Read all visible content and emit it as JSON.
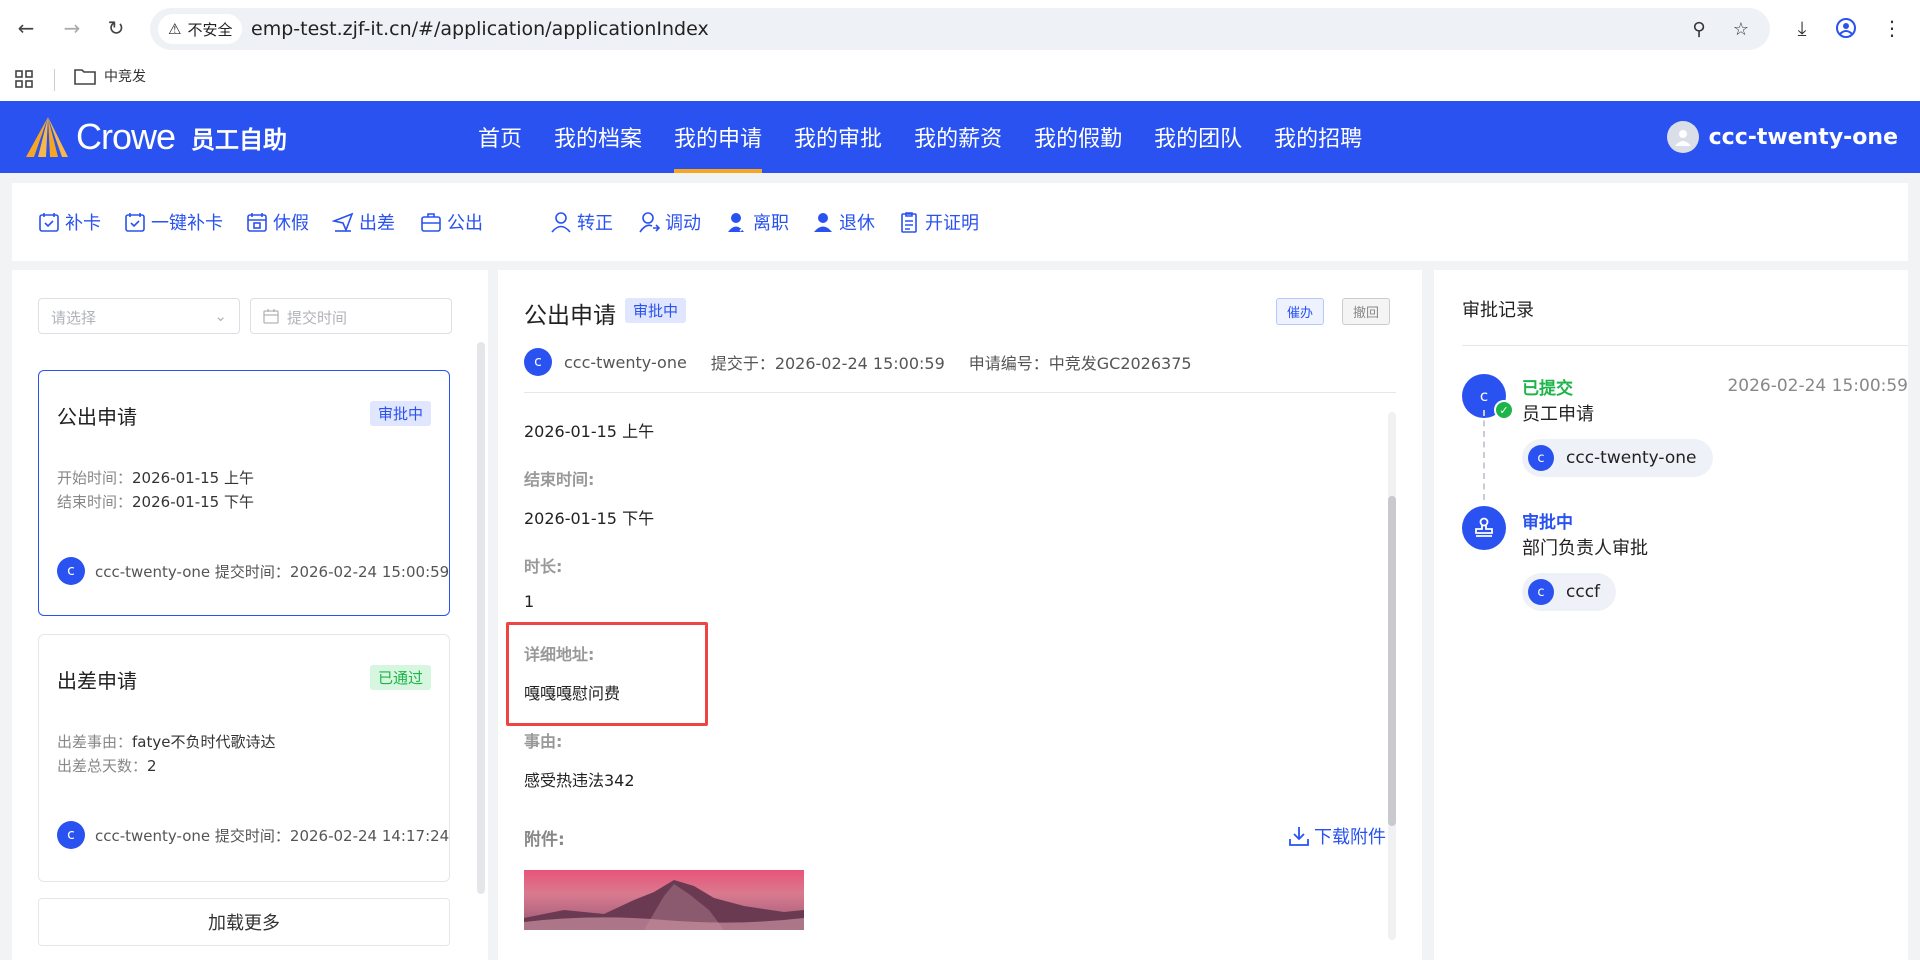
{
  "browser": {
    "security_label": "不安全",
    "url": "emp-test.zjf-it.cn/#/application/applicationIndex",
    "bookmark_folder": "中竞发"
  },
  "header": {
    "logo_text": "Crowe",
    "logo_sub": "员工自助",
    "nav": [
      {
        "label": "首页"
      },
      {
        "label": "我的档案"
      },
      {
        "label": "我的申请",
        "active": true
      },
      {
        "label": "我的审批"
      },
      {
        "label": "我的薪资"
      },
      {
        "label": "我的假勤"
      },
      {
        "label": "我的团队"
      },
      {
        "label": "我的招聘"
      }
    ],
    "username": "ccc-twenty-one"
  },
  "quick_actions": [
    {
      "label": "补卡",
      "icon": "calendar-check-icon"
    },
    {
      "label": "一键补卡",
      "icon": "calendar-check-icon"
    },
    {
      "label": "休假",
      "icon": "calendar-leave-icon"
    },
    {
      "label": "出差",
      "icon": "plane-icon"
    },
    {
      "label": "公出",
      "icon": "briefcase-icon"
    },
    {
      "label": "转正",
      "icon": "user-icon"
    },
    {
      "label": "调动",
      "icon": "user-transfer-icon"
    },
    {
      "label": "离职",
      "icon": "user-leave-icon"
    },
    {
      "label": "退休",
      "icon": "user-retire-icon"
    },
    {
      "label": "开证明",
      "icon": "document-icon"
    }
  ],
  "filters": {
    "select_placeholder": "请选择",
    "date_placeholder": "提交时间"
  },
  "cards": [
    {
      "title": "公出申请",
      "status": "审批中",
      "line1_key": "开始时间：",
      "line1_val": "2026-01-15 上午",
      "line2_key": "结束时间：",
      "line2_val": "2026-01-15 下午",
      "avatar": "c",
      "footer": "ccc-twenty-one 提交时间：2026-02-24 15:00:59"
    },
    {
      "title": "出差申请",
      "status": "已通过",
      "line1_key": "出差事由：",
      "line1_val": "fatye不负时代歌诗达",
      "line2_key": "出差总天数：",
      "line2_val": "2",
      "avatar": "c",
      "footer": "ccc-twenty-one 提交时间：2026-02-24 14:17:24"
    }
  ],
  "load_more": "加载更多",
  "detail": {
    "title": "公出申请",
    "status": "审批中",
    "urge_button": "催办",
    "withdraw_button": "撤回",
    "avatar": "c",
    "applicant": "ccc-twenty-one",
    "submitted": "提交于：2026-02-24 15:00:59",
    "number": "申请编号：中竞发GC2026375",
    "start_value": "2026-01-15 上午",
    "end_label": "结束时间:",
    "end_value": "2026-01-15 下午",
    "duration_label": "时长:",
    "duration_value": "1",
    "address_label": "详细地址:",
    "address_value": "嘎嘎嘎慰问费",
    "reason_label": "事由:",
    "reason_value": "感受热违法342",
    "attachment_label": "附件:",
    "download_label": "下载附件"
  },
  "records": {
    "title": "审批记录",
    "steps": [
      {
        "avatar": "c",
        "status": "已提交",
        "status_color": "#1db44a",
        "desc": "员工申请",
        "time": "2026-02-24 15:00:59",
        "person_avatar": "c",
        "person": "ccc-twenty-one"
      },
      {
        "icon": "stamp-icon",
        "status": "审批中",
        "status_color": "#2a52f0",
        "desc": "部门负责人审批",
        "person_avatar": "c",
        "person": "cccf"
      }
    ]
  }
}
